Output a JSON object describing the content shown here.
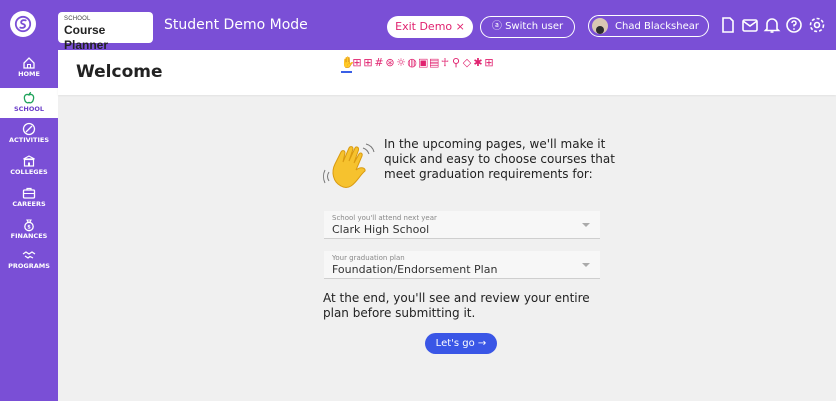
{
  "topbar": {
    "app_small_label": "SCHOOL",
    "app_name": "Course Planner",
    "mode_title": "Student Demo Mode",
    "exit_demo_label": "Exit Demo ×",
    "switch_user_label": "Switch user",
    "user_name": "Chad Blackshear",
    "icons": [
      "document-icon",
      "mail-icon",
      "bell-icon",
      "help-icon",
      "gear-icon"
    ]
  },
  "sidebar": {
    "items": [
      {
        "label": "HOME",
        "icon": "home-icon"
      },
      {
        "label": "SCHOOL",
        "icon": "apple-icon",
        "active": true
      },
      {
        "label": "ACTIVITIES",
        "icon": "activities-icon"
      },
      {
        "label": "COLLEGES",
        "icon": "college-icon"
      },
      {
        "label": "CAREERS",
        "icon": "briefcase-icon"
      },
      {
        "label": "FINANCES",
        "icon": "money-bag-icon"
      },
      {
        "label": "PROGRAMS",
        "icon": "handshake-icon"
      }
    ]
  },
  "main": {
    "page_title": "Welcome",
    "step_icon_glyphs": [
      "✋",
      "⊞",
      "⊞",
      "#",
      "⊛",
      "☼",
      "◍",
      "▣",
      "▤",
      "☥",
      "⚲",
      "◇",
      "✱",
      "⊞"
    ],
    "intro_text": "In the upcoming pages, we'll make it quick and easy to choose courses that meet graduation requirements for:",
    "school_field": {
      "label": "School you'll attend next year",
      "value": "Clark High School"
    },
    "plan_field": {
      "label": "Your graduation plan",
      "value": "Foundation/Endorsement Plan"
    },
    "end_text": "At the end, you'll see and review your entire plan before submitting it.",
    "lets_go_label": "Let's go →"
  },
  "colors": {
    "brand_purple": "#7a4fd6",
    "accent_pink": "#e0226f",
    "button_blue": "#3a56e6"
  }
}
